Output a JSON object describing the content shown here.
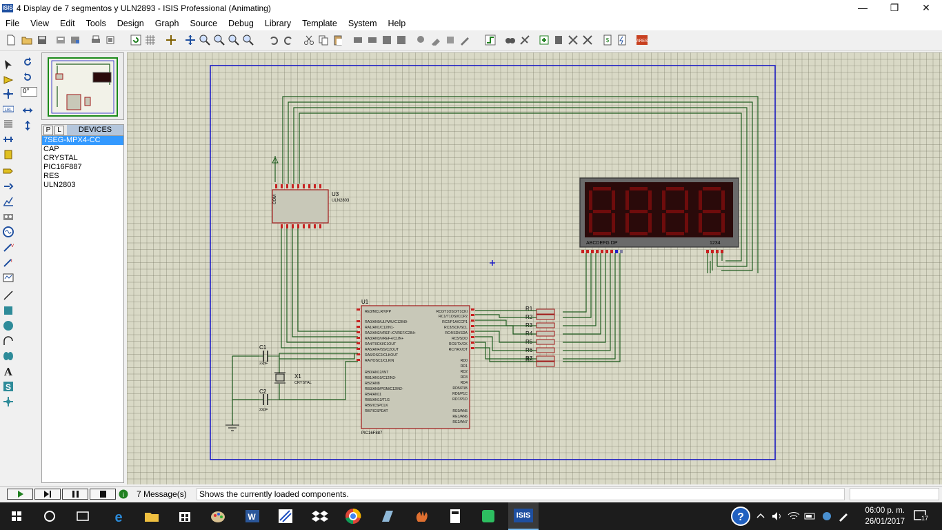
{
  "window": {
    "app_icon": "ISIS",
    "title": "4 Display de 7 segmentos y ULN2893 - ISIS Professional (Animating)",
    "minimize": "—",
    "restore": "❐",
    "close": "✕"
  },
  "menu": [
    "File",
    "View",
    "Edit",
    "Tools",
    "Design",
    "Graph",
    "Source",
    "Debug",
    "Library",
    "Template",
    "System",
    "Help"
  ],
  "left_panel": {
    "angle": "0°",
    "devices_header": "DEVICES",
    "p_btn": "P",
    "l_btn": "L",
    "devices": [
      "7SEG-MPX4-CC",
      "CAP",
      "CRYSTAL",
      "PIC16F887",
      "RES",
      "ULN2803"
    ],
    "selected_device": "7SEG-MPX4-CC"
  },
  "schematic": {
    "u3_label": "U3",
    "u3_part": "ULN2803",
    "u3_pin_com": "COM",
    "display_seg_labels": "ABCDEFG  DP",
    "display_digit_labels": "1234",
    "u1_label": "U1",
    "u1_part": "PIC16F887",
    "c1_label": "C1",
    "c1_value": "22pF",
    "c2_label": "C2",
    "c2_value": "22pF",
    "x1_label": "X1",
    "x1_value": "CRYSTAL",
    "r_labels": [
      "R1",
      "R2",
      "R3",
      "R4",
      "R5",
      "R6",
      "R7",
      "R8"
    ],
    "u1_left_pins": [
      "RE3/MCLR/VPP",
      "RA0/AN0/ULPWU/C12IN0-",
      "RA1/AN1/C12IN1-",
      "RA2/AN2/VREF-/CVREF/C2IN+",
      "RA3/AN3/VREF+/C1IN+",
      "RA4/T0CKI/C1OUT",
      "RA5/AN4/SS/C2OUT",
      "RA6/OSC2/CLKOUT",
      "RA7/OSC1/CLKIN",
      "RB0/AN12/INT",
      "RB1/AN10/C12IN3-",
      "RB2/AN8",
      "RB3/AN9/PGM/C12IN2-",
      "RB4/AN11",
      "RB5/AN13/T1G",
      "RB6/ICSPCLK",
      "RB7/ICSPDAT"
    ],
    "u1_right_pins": [
      "RC0/T1OSO/T1CKI",
      "RC1/T1OSI/CCP2",
      "RC2/P1A/CCP1",
      "RC3/SCK/SCL",
      "RC4/SDI/SDA",
      "RC5/SDO",
      "RC6/TX/CK",
      "RC7/RX/DT",
      "RD0",
      "RD1",
      "RD2",
      "RD3",
      "RD4",
      "RD5/P1B",
      "RD6/P1C",
      "RD7/P1D",
      "RE0/AN5",
      "RE1/AN6",
      "RE2/AN7"
    ]
  },
  "status": {
    "messages": "7 Message(s)",
    "info": "Shows the currently loaded components."
  },
  "taskbar": {
    "time": "06:00 p. m.",
    "date": "26/01/2017",
    "notifications": "17",
    "active_app": "ISIS"
  },
  "colors": {
    "wire": "#1f5c1f",
    "component_outline": "#a01818",
    "component_fill": "#c8c8b8",
    "sheet_border": "#1414c8",
    "display_bg": "#2a0a0a",
    "display_seg": "#6e0c0c",
    "selection": "#3399ff"
  }
}
